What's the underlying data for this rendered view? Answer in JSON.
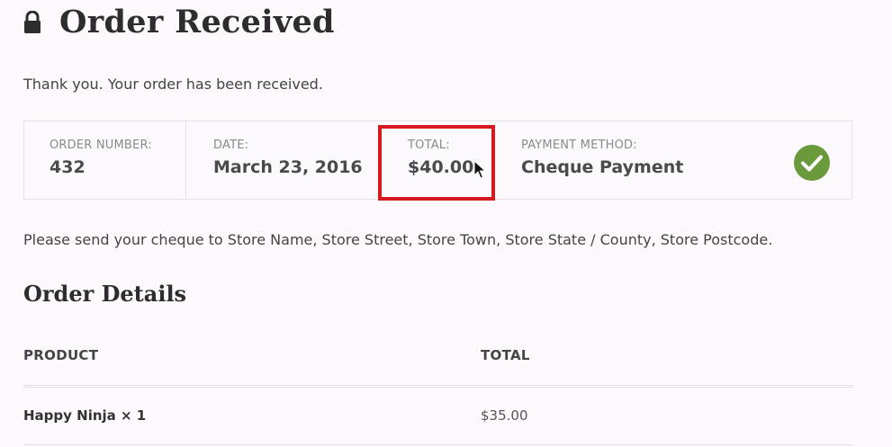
{
  "header": {
    "title": "Order Received"
  },
  "messages": {
    "thank_you": "Thank you. Your order has been received.",
    "cheque_note": "Please send your cheque to Store Name, Store Street, Store Town, Store State / County, Store Postcode."
  },
  "overview": {
    "order_number": {
      "label": "ORDER NUMBER:",
      "value": "432"
    },
    "date": {
      "label": "DATE:",
      "value": "March 23, 2016"
    },
    "total": {
      "label": "TOTAL:",
      "value": "$40.00"
    },
    "payment_method": {
      "label": "PAYMENT METHOD:",
      "value": "Cheque Payment"
    },
    "status_icon": "check-circle-icon",
    "highlight_color": "#d71920",
    "check_color": "#6b9a3c"
  },
  "order_details": {
    "title": "Order Details",
    "columns": [
      "PRODUCT",
      "TOTAL"
    ],
    "rows": [
      {
        "product": "Happy Ninja × 1",
        "total": "$35.00"
      }
    ]
  }
}
